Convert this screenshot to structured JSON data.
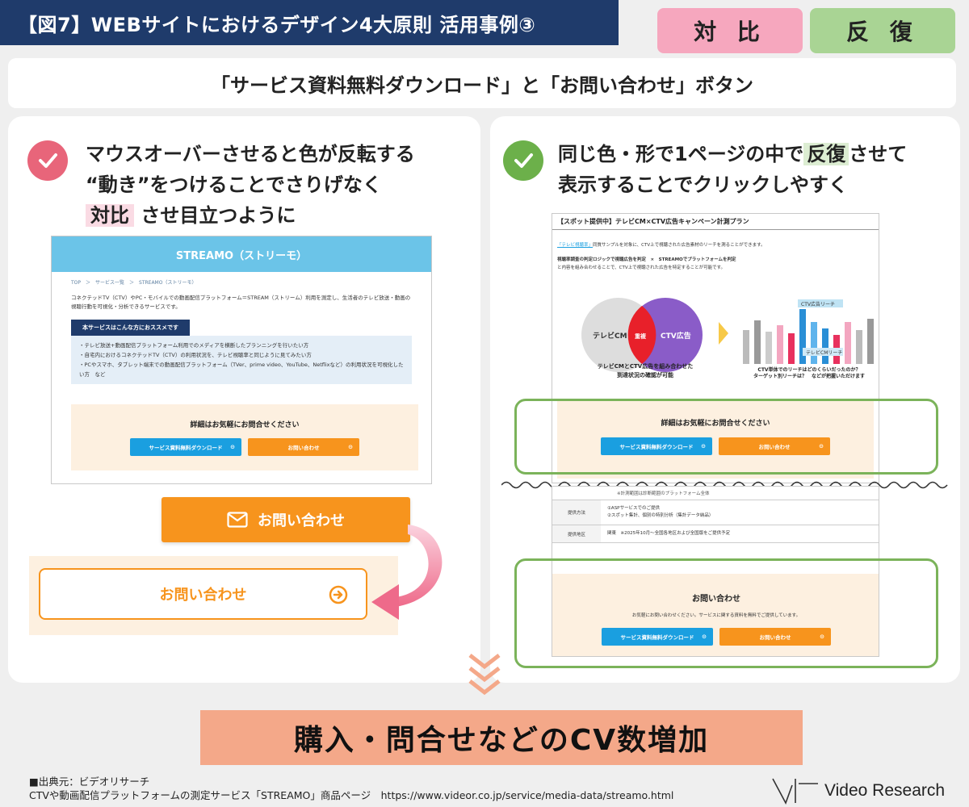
{
  "header": {
    "title": "【図7】WEBサイトにおけるデザイン4大原則 活用事例③",
    "tag_contrast": "対 比",
    "tag_repeat": "反 復"
  },
  "subtitle": "「サービス資料無料ダウンロード」と「お問い合わせ」ボタン",
  "left_panel": {
    "heading_line1": "マウスオーバーさせると色が反転する",
    "heading_line2": "“動き”をつけることでさりげなく",
    "heading_highlight": "対比",
    "heading_line3_rest": "させ目立つように",
    "mockup": {
      "header": "STREAMO（ストリーモ）",
      "breadcrumb": "TOP　＞　サービス一覧　＞　STREAMO（ストリーモ）",
      "description": "コネクテッドTV（CTV）やPC・モバイルでの動画配信プラットフォーム＝STREAM（ストリーム）利用を測定し、生活者のテレビ放送・動画の視聴行動を可視化・分析できるサービスです。",
      "recommend_label": "本サービスはこんな方におススメです",
      "recommend_items": [
        "・テレビ放送+動画配信プラットフォーム利用でのメディアを横断したプランニングを行いたい方",
        "・自宅内におけるコネクテッドTV（CTV）の利用状況を、テレビ視聴率と同じように見てみたい方",
        "・PCやスマホ、タブレット端末での動画配信プラットフォーム（TVer、prime video、YouTube、Netflixなど）の利用状況を可視化したい方　など"
      ],
      "cta_title": "詳細はお気軽にお問合せください",
      "download_button": "サービス資料無料ダウンロード",
      "contact_button": "お問い合わせ"
    },
    "contact_button_normal": "お問い合わせ",
    "contact_button_hover": "お問い合わせ"
  },
  "right_panel": {
    "heading_line1_pre": "同じ色・形で1ページの中で",
    "heading_highlight": "反復",
    "heading_line1_post": "させて",
    "heading_line2": "表示することでクリックしやすく",
    "mockup": {
      "title": "【スポット提供中】テレビCM×CTV広告キャンペーン計測プラン",
      "text_link": "「テレビ視聴率」",
      "text1": "同質サンプルを対象に、CTV上で視聴された広告素材のリーチを測ることができます。",
      "text2": "視聴率調査の判定ロジックで視聴広告を判定　×　STREAMOでプラットフォームを判定",
      "text3": "と内容を組み合わせることで、CTV上で視聴された広告を特定することが可能です。",
      "venn_left": "テレビCM",
      "venn_overlap": "重複",
      "venn_right": "CTV広告",
      "venn_caption_1": "テレビCMとCTV広告を組み合わせた",
      "venn_caption_2": "到達状況の確認が可能",
      "bars_label_top": "CTV広告リーチ",
      "bars_label_mid": "テレビCMリーチ",
      "bars_caption_1": "CTV単体でのリーチはどのくらいだったのか？",
      "bars_caption_2": "ターゲット別リーチは？　などが把握いただけます",
      "cta_title": "詳細はお気軽にお問合せください",
      "download_button": "サービス資料無料ダウンロード",
      "contact_button": "お問い合わせ"
    },
    "mockup2": {
      "top_note": "※計測範囲は診断範囲のプラットフォーム全体",
      "row1_label": "提供方法",
      "row1_value_1": "①ASPサービスでのご提供",
      "row1_value_2": "②スポット集計、個別の特別分析（集計データ納品）",
      "row2_label": "提供地区",
      "row2_value": "関東　※2025年10月～全国各地区および全国版をご提供予定",
      "cta_title": "お問い合わせ",
      "cta_sub": "お気軽にお問い合わせください。サービスに関する資料を無料でご提供しています。",
      "download_button": "サービス資料無料ダウンロード",
      "contact_button": "お問い合わせ"
    }
  },
  "result": "購入・問合せなどのCV数増加",
  "source": {
    "line1": "■出典元：ビデオリサーチ",
    "line2": "CTVや動画配信プラットフォームの測定サービス「STREAMO」商品ページ　https://www.videor.co.jp/service/media-data/streamo.html"
  },
  "logo": {
    "text": "Video Research"
  },
  "colors": {
    "navy": "#1f3b6b",
    "pink": "#f6a7be",
    "green": "#a9d494",
    "orange": "#f7941d",
    "blue": "#1a9fe0",
    "salmon": "#f4a889"
  }
}
